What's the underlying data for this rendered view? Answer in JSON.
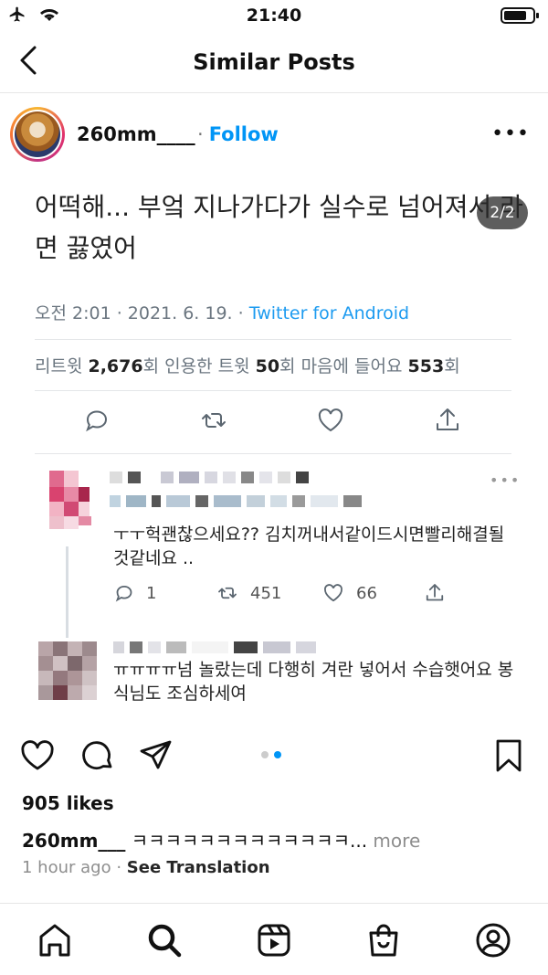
{
  "status_bar": {
    "time": "21:40",
    "icons": [
      "airplane-icon",
      "wifi-icon",
      "battery-icon"
    ]
  },
  "nav": {
    "title": "Similar Posts",
    "back_icon": "chevron-left-icon"
  },
  "post": {
    "username": "260mm____",
    "follow_separator": "·",
    "follow_label": "Follow",
    "more_label": "•••",
    "image_counter": "2/2",
    "tweet": {
      "text": "어떡해... 부엌 지나가다가 실수로 넘어져서 라면 끓였어",
      "meta_time": "오전 2:01 · 2021. 6. 19. · ",
      "meta_source": "Twitter for Android",
      "stats": {
        "retweet_label": "리트윗 ",
        "retweet_count": "2,676",
        "retweet_suffix": "회  인용한 트윗 ",
        "quote_count": "50",
        "quote_suffix": "회  마음에 들어요 ",
        "like_count": "553",
        "like_suffix": "회"
      }
    },
    "replies": [
      {
        "text": "ㅜㅜ헉괜찮으세요?? 김치꺼내서같이드시면빨리해결될것같네요 ..",
        "reply_count": "1",
        "retweet_count": "451",
        "like_count": "66",
        "more_label": "•••"
      },
      {
        "text": "ㅠㅠㅠㅠ넘 놀랐는데 다행히 겨란 넣어서 수습햇어요 봉식님도 조심하세여"
      }
    ],
    "likes": "905 likes",
    "caption_user": "260mm___",
    "caption_text": " ㅋㅋㅋㅋㅋㅋㅋㅋㅋㅋㅋㅋㅋ...",
    "caption_more": " more",
    "time_ago": "1 hour ago",
    "time_sep": " · ",
    "see_translation": "See Translation",
    "carousel": {
      "current": 2,
      "total": 2
    }
  },
  "tabbar": [
    "home-icon",
    "search-icon",
    "reels-icon",
    "shop-icon",
    "profile-icon"
  ],
  "colors": {
    "link_blue": "#0095f6",
    "twitter_blue": "#1d9bf0",
    "muted": "#8e8e8e"
  }
}
